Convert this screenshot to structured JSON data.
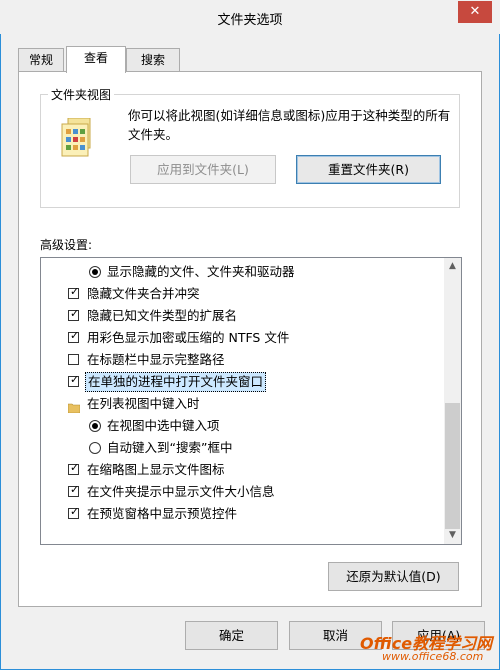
{
  "window": {
    "title": "文件夹选项",
    "close_glyph": "✕"
  },
  "tabs": [
    {
      "label": "常规"
    },
    {
      "label": "查看"
    },
    {
      "label": "搜索"
    }
  ],
  "folder_views": {
    "legend": "文件夹视图",
    "description": "你可以将此视图(如详细信息或图标)应用于这种类型的所有文件夹。",
    "apply_button": "应用到文件夹(L)",
    "reset_button": "重置文件夹(R)"
  },
  "advanced": {
    "label": "高级设置:",
    "items": [
      {
        "type": "radio",
        "checked": true,
        "label": "显示隐藏的文件、文件夹和驱动器"
      },
      {
        "type": "checkbox",
        "checked": true,
        "label": "隐藏文件夹合并冲突"
      },
      {
        "type": "checkbox",
        "checked": true,
        "label": "隐藏已知文件类型的扩展名"
      },
      {
        "type": "checkbox",
        "checked": true,
        "label": "用彩色显示加密或压缩的 NTFS 文件"
      },
      {
        "type": "checkbox",
        "checked": false,
        "label": "在标题栏中显示完整路径"
      },
      {
        "type": "checkbox",
        "checked": true,
        "label": "在单独的进程中打开文件夹窗口",
        "selected": true
      },
      {
        "type": "folder",
        "label": "在列表视图中键入时"
      },
      {
        "type": "radio",
        "checked": true,
        "label": "在视图中选中键入项"
      },
      {
        "type": "radio",
        "checked": false,
        "label": "自动键入到“搜索”框中"
      },
      {
        "type": "checkbox",
        "checked": true,
        "label": "在缩略图上显示文件图标"
      },
      {
        "type": "checkbox",
        "checked": true,
        "label": "在文件夹提示中显示文件大小信息"
      },
      {
        "type": "checkbox",
        "checked": true,
        "label": "在预览窗格中显示预览控件"
      }
    ],
    "restore_button": "还原为默认值(D)"
  },
  "footer": {
    "ok_button": "确定",
    "cancel_button": "取消",
    "apply_button": "应用(A)"
  },
  "watermark": {
    "text": "Office教程学习网",
    "url": "www.office68.com"
  },
  "colors": {
    "selection": "#cce8ff",
    "close_button": "#c7493e",
    "window_border": "#2b8fd9",
    "watermark": "#e05a00"
  }
}
